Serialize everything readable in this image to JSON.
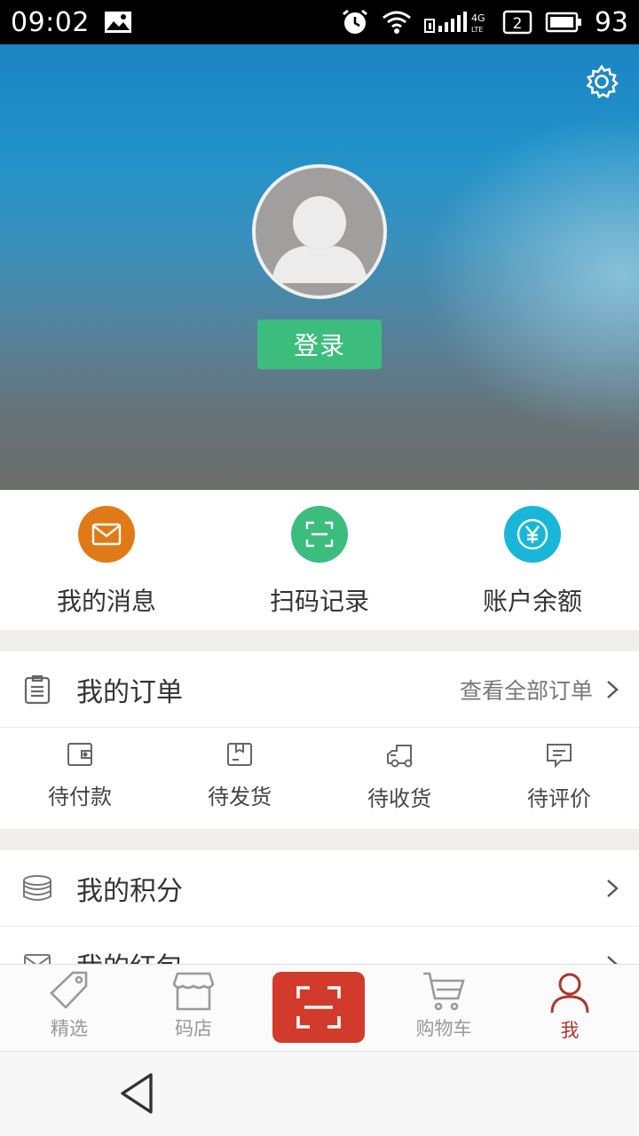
{
  "status_bar": {
    "time": "09:02",
    "sim_slot": "2",
    "battery": "93"
  },
  "header": {
    "login_label": "登录"
  },
  "quick_actions": [
    {
      "label": "我的消息",
      "icon": "mail-icon",
      "color": "#e07a16"
    },
    {
      "label": "扫码记录",
      "icon": "scan-icon",
      "color": "#3cbd7e"
    },
    {
      "label": "账户余额",
      "icon": "yen-icon",
      "color": "#1ab6d7"
    }
  ],
  "orders": {
    "title": "我的订单",
    "view_all": "查看全部订单",
    "tabs": [
      {
        "label": "待付款",
        "icon": "wallet-icon"
      },
      {
        "label": "待发货",
        "icon": "box-icon"
      },
      {
        "label": "待收货",
        "icon": "truck-icon"
      },
      {
        "label": "待评价",
        "icon": "comment-icon"
      }
    ]
  },
  "list": [
    {
      "label": "我的积分",
      "icon": "coins-icon"
    },
    {
      "label": "我的红包",
      "icon": "envelope-icon"
    }
  ],
  "tab_bar": {
    "items": [
      {
        "label": "精选",
        "icon": "tag-icon"
      },
      {
        "label": "码店",
        "icon": "store-icon"
      },
      {
        "label": "",
        "icon": "scan-icon"
      },
      {
        "label": "购物车",
        "icon": "cart-icon"
      },
      {
        "label": "我",
        "icon": "user-icon"
      }
    ],
    "active_index": 4,
    "active_color": "#a9372e",
    "fab_color": "#d23a2b"
  }
}
